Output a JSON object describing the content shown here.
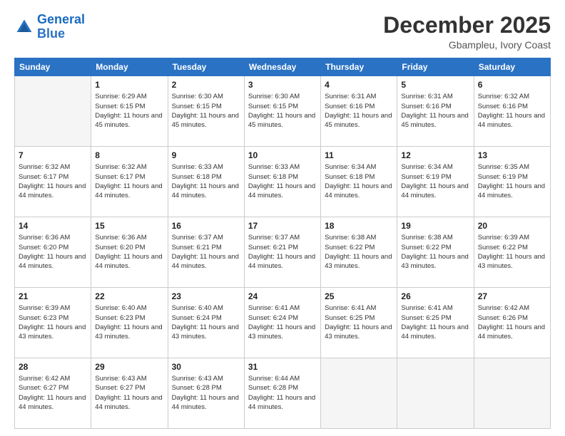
{
  "header": {
    "logo_line1": "General",
    "logo_line2": "Blue",
    "month_year": "December 2025",
    "location": "Gbampleu, Ivory Coast"
  },
  "weekdays": [
    "Sunday",
    "Monday",
    "Tuesday",
    "Wednesday",
    "Thursday",
    "Friday",
    "Saturday"
  ],
  "weeks": [
    [
      {
        "day": "",
        "sunrise": "",
        "sunset": "",
        "daylight": ""
      },
      {
        "day": "1",
        "sunrise": "Sunrise: 6:29 AM",
        "sunset": "Sunset: 6:15 PM",
        "daylight": "Daylight: 11 hours and 45 minutes."
      },
      {
        "day": "2",
        "sunrise": "Sunrise: 6:30 AM",
        "sunset": "Sunset: 6:15 PM",
        "daylight": "Daylight: 11 hours and 45 minutes."
      },
      {
        "day": "3",
        "sunrise": "Sunrise: 6:30 AM",
        "sunset": "Sunset: 6:15 PM",
        "daylight": "Daylight: 11 hours and 45 minutes."
      },
      {
        "day": "4",
        "sunrise": "Sunrise: 6:31 AM",
        "sunset": "Sunset: 6:16 PM",
        "daylight": "Daylight: 11 hours and 45 minutes."
      },
      {
        "day": "5",
        "sunrise": "Sunrise: 6:31 AM",
        "sunset": "Sunset: 6:16 PM",
        "daylight": "Daylight: 11 hours and 45 minutes."
      },
      {
        "day": "6",
        "sunrise": "Sunrise: 6:32 AM",
        "sunset": "Sunset: 6:16 PM",
        "daylight": "Daylight: 11 hours and 44 minutes."
      }
    ],
    [
      {
        "day": "7",
        "sunrise": "Sunrise: 6:32 AM",
        "sunset": "Sunset: 6:17 PM",
        "daylight": "Daylight: 11 hours and 44 minutes."
      },
      {
        "day": "8",
        "sunrise": "Sunrise: 6:32 AM",
        "sunset": "Sunset: 6:17 PM",
        "daylight": "Daylight: 11 hours and 44 minutes."
      },
      {
        "day": "9",
        "sunrise": "Sunrise: 6:33 AM",
        "sunset": "Sunset: 6:18 PM",
        "daylight": "Daylight: 11 hours and 44 minutes."
      },
      {
        "day": "10",
        "sunrise": "Sunrise: 6:33 AM",
        "sunset": "Sunset: 6:18 PM",
        "daylight": "Daylight: 11 hours and 44 minutes."
      },
      {
        "day": "11",
        "sunrise": "Sunrise: 6:34 AM",
        "sunset": "Sunset: 6:18 PM",
        "daylight": "Daylight: 11 hours and 44 minutes."
      },
      {
        "day": "12",
        "sunrise": "Sunrise: 6:34 AM",
        "sunset": "Sunset: 6:19 PM",
        "daylight": "Daylight: 11 hours and 44 minutes."
      },
      {
        "day": "13",
        "sunrise": "Sunrise: 6:35 AM",
        "sunset": "Sunset: 6:19 PM",
        "daylight": "Daylight: 11 hours and 44 minutes."
      }
    ],
    [
      {
        "day": "14",
        "sunrise": "Sunrise: 6:36 AM",
        "sunset": "Sunset: 6:20 PM",
        "daylight": "Daylight: 11 hours and 44 minutes."
      },
      {
        "day": "15",
        "sunrise": "Sunrise: 6:36 AM",
        "sunset": "Sunset: 6:20 PM",
        "daylight": "Daylight: 11 hours and 44 minutes."
      },
      {
        "day": "16",
        "sunrise": "Sunrise: 6:37 AM",
        "sunset": "Sunset: 6:21 PM",
        "daylight": "Daylight: 11 hours and 44 minutes."
      },
      {
        "day": "17",
        "sunrise": "Sunrise: 6:37 AM",
        "sunset": "Sunset: 6:21 PM",
        "daylight": "Daylight: 11 hours and 44 minutes."
      },
      {
        "day": "18",
        "sunrise": "Sunrise: 6:38 AM",
        "sunset": "Sunset: 6:22 PM",
        "daylight": "Daylight: 11 hours and 43 minutes."
      },
      {
        "day": "19",
        "sunrise": "Sunrise: 6:38 AM",
        "sunset": "Sunset: 6:22 PM",
        "daylight": "Daylight: 11 hours and 43 minutes."
      },
      {
        "day": "20",
        "sunrise": "Sunrise: 6:39 AM",
        "sunset": "Sunset: 6:22 PM",
        "daylight": "Daylight: 11 hours and 43 minutes."
      }
    ],
    [
      {
        "day": "21",
        "sunrise": "Sunrise: 6:39 AM",
        "sunset": "Sunset: 6:23 PM",
        "daylight": "Daylight: 11 hours and 43 minutes."
      },
      {
        "day": "22",
        "sunrise": "Sunrise: 6:40 AM",
        "sunset": "Sunset: 6:23 PM",
        "daylight": "Daylight: 11 hours and 43 minutes."
      },
      {
        "day": "23",
        "sunrise": "Sunrise: 6:40 AM",
        "sunset": "Sunset: 6:24 PM",
        "daylight": "Daylight: 11 hours and 43 minutes."
      },
      {
        "day": "24",
        "sunrise": "Sunrise: 6:41 AM",
        "sunset": "Sunset: 6:24 PM",
        "daylight": "Daylight: 11 hours and 43 minutes."
      },
      {
        "day": "25",
        "sunrise": "Sunrise: 6:41 AM",
        "sunset": "Sunset: 6:25 PM",
        "daylight": "Daylight: 11 hours and 43 minutes."
      },
      {
        "day": "26",
        "sunrise": "Sunrise: 6:41 AM",
        "sunset": "Sunset: 6:25 PM",
        "daylight": "Daylight: 11 hours and 44 minutes."
      },
      {
        "day": "27",
        "sunrise": "Sunrise: 6:42 AM",
        "sunset": "Sunset: 6:26 PM",
        "daylight": "Daylight: 11 hours and 44 minutes."
      }
    ],
    [
      {
        "day": "28",
        "sunrise": "Sunrise: 6:42 AM",
        "sunset": "Sunset: 6:27 PM",
        "daylight": "Daylight: 11 hours and 44 minutes."
      },
      {
        "day": "29",
        "sunrise": "Sunrise: 6:43 AM",
        "sunset": "Sunset: 6:27 PM",
        "daylight": "Daylight: 11 hours and 44 minutes."
      },
      {
        "day": "30",
        "sunrise": "Sunrise: 6:43 AM",
        "sunset": "Sunset: 6:28 PM",
        "daylight": "Daylight: 11 hours and 44 minutes."
      },
      {
        "day": "31",
        "sunrise": "Sunrise: 6:44 AM",
        "sunset": "Sunset: 6:28 PM",
        "daylight": "Daylight: 11 hours and 44 minutes."
      },
      {
        "day": "",
        "sunrise": "",
        "sunset": "",
        "daylight": ""
      },
      {
        "day": "",
        "sunrise": "",
        "sunset": "",
        "daylight": ""
      },
      {
        "day": "",
        "sunrise": "",
        "sunset": "",
        "daylight": ""
      }
    ]
  ]
}
